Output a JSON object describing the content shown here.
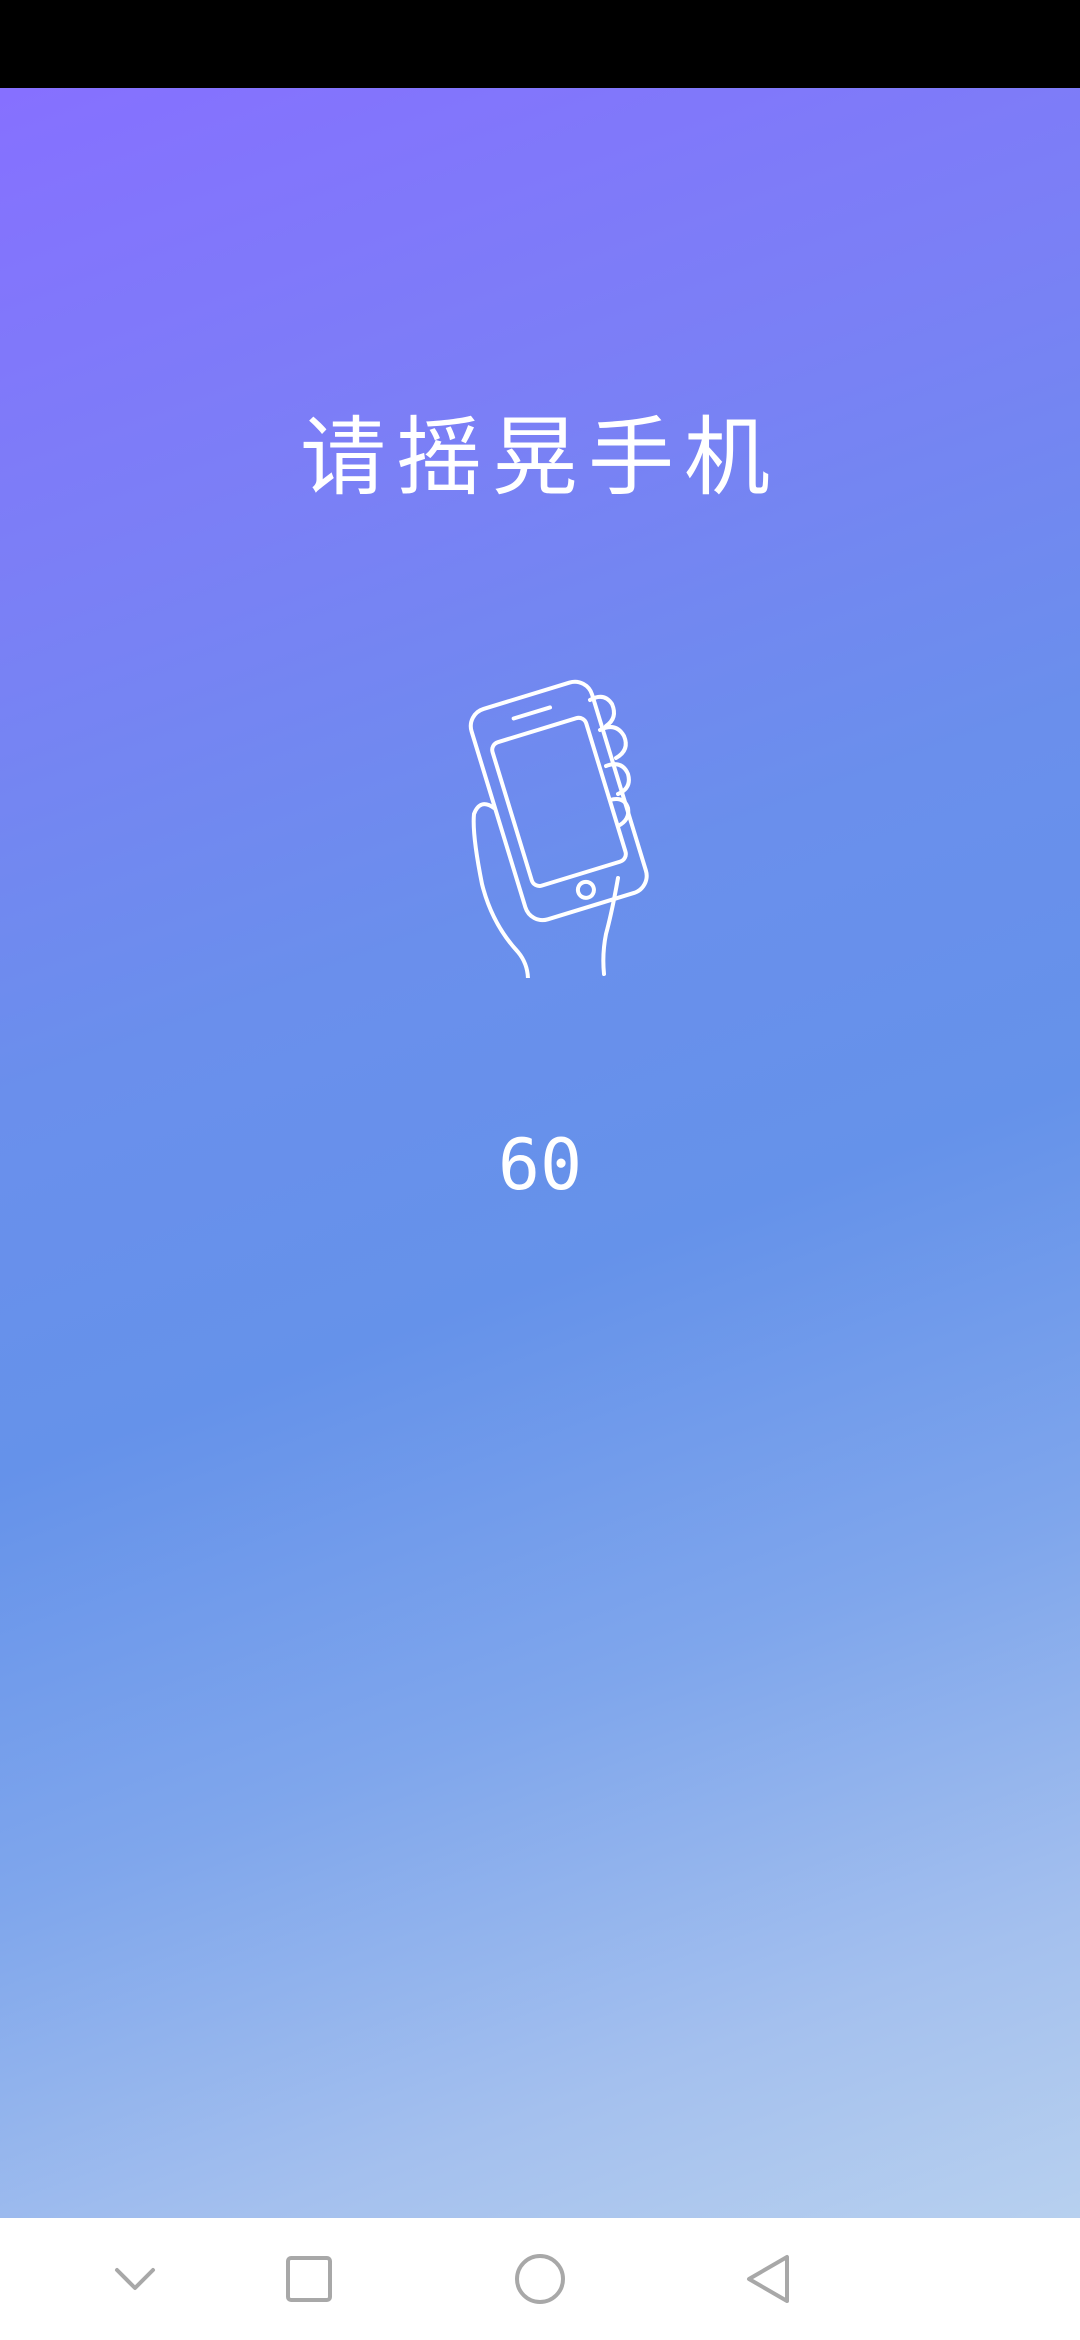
{
  "screen": {
    "title": "请摇晃手机",
    "countdown": "60",
    "illustration_icon": "hand-holding-phone-icon"
  },
  "nav_bar": {
    "items": [
      {
        "icon": "chevron-down-icon"
      },
      {
        "icon": "square-recents-icon"
      },
      {
        "icon": "circle-home-icon"
      },
      {
        "icon": "triangle-back-icon"
      }
    ]
  },
  "colors": {
    "gradient_top": "#8670ff",
    "gradient_mid": "#6592ea",
    "gradient_bottom": "#b7d0ef",
    "text": "#ffffff",
    "nav_icon": "#a8a8a8"
  }
}
